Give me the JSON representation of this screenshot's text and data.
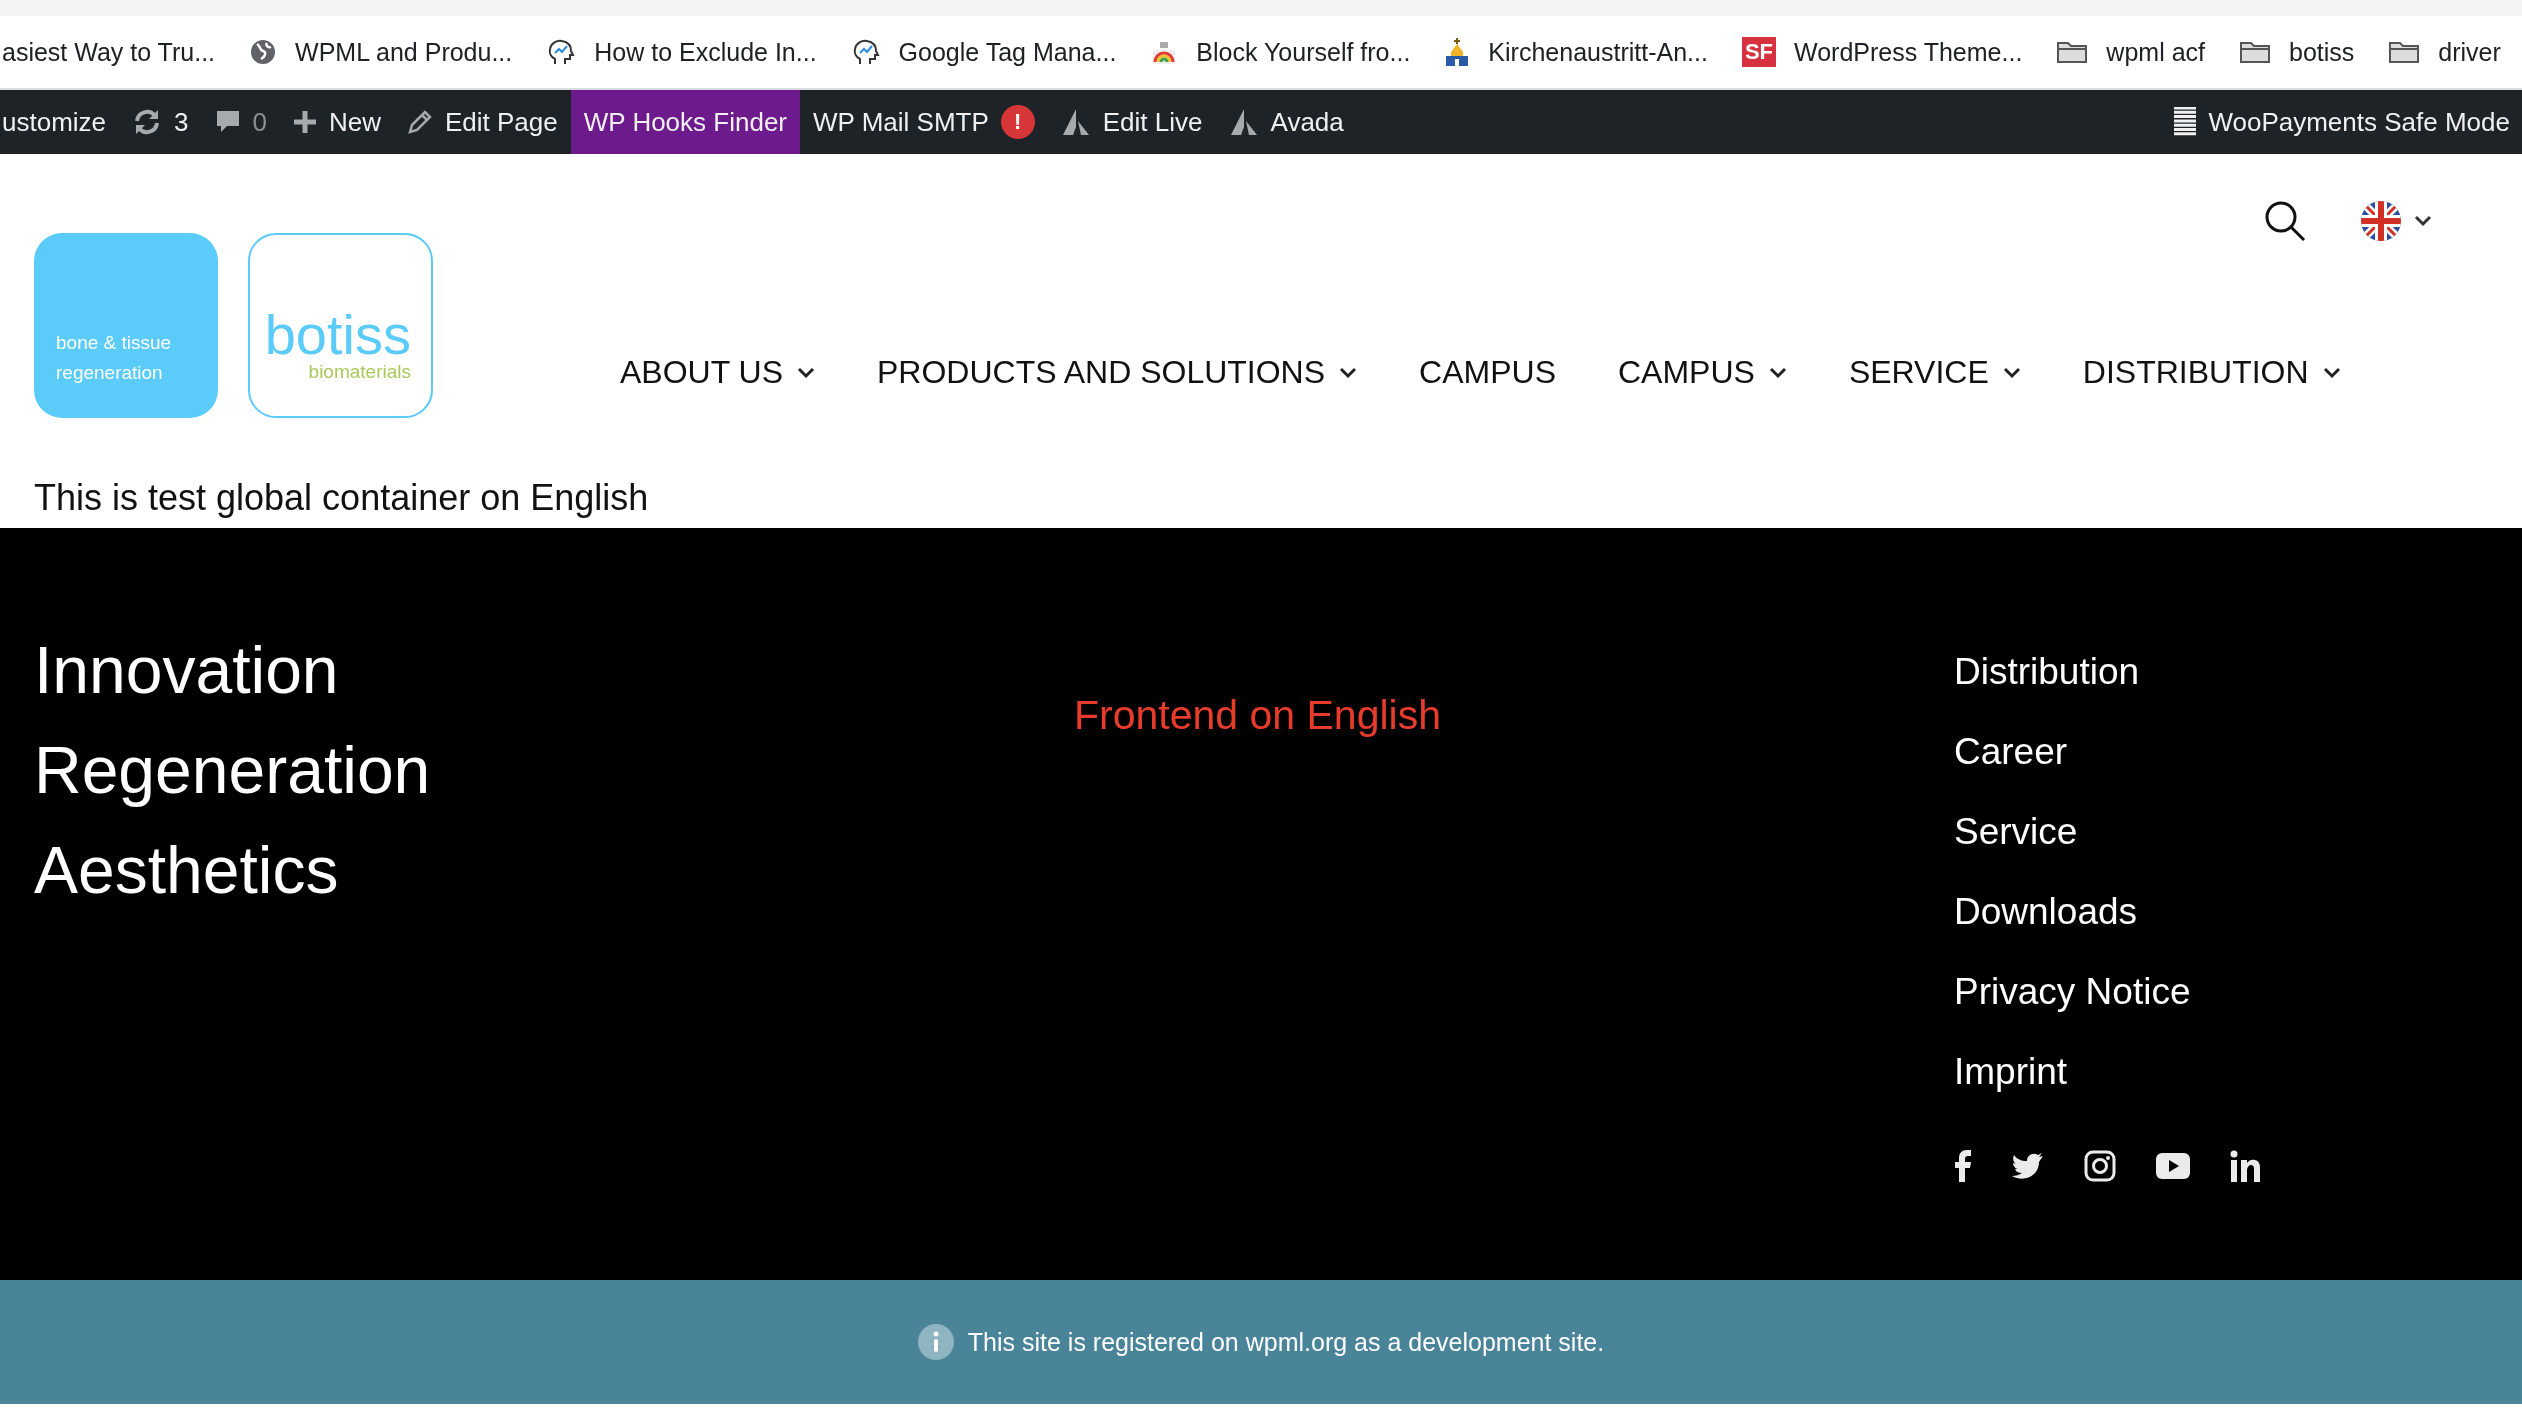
{
  "bookmarks_bar": {
    "items": [
      {
        "label": "asiest Way to Tru...",
        "kind": "none"
      },
      {
        "label": "WPML and Produ...",
        "kind": "globe"
      },
      {
        "label": "How to Exclude In...",
        "kind": "head"
      },
      {
        "label": "Google Tag Mana...",
        "kind": "head"
      },
      {
        "label": "Block Yourself fro...",
        "kind": "rainbow"
      },
      {
        "label": "Kirchenaustritt-An...",
        "kind": "church"
      },
      {
        "label": "WordPress Theme...",
        "kind": "badge",
        "badge": "SF"
      },
      {
        "label": "wpml acf",
        "kind": "folder"
      },
      {
        "label": "botiss",
        "kind": "folder"
      },
      {
        "label": "driver",
        "kind": "folder"
      }
    ]
  },
  "admin_bar": {
    "items": [
      {
        "label": "ustomize",
        "kind": "none",
        "highlighted": false
      },
      {
        "label": "3",
        "kind": "sync",
        "highlighted": false
      },
      {
        "label": "0",
        "kind": "comment",
        "highlighted": false
      },
      {
        "label": "New",
        "kind": "plus",
        "highlighted": false
      },
      {
        "label": "Edit Page",
        "kind": "pencil",
        "highlighted": false
      },
      {
        "label": "WP Hooks Finder",
        "kind": "none",
        "highlighted": true
      },
      {
        "label": "WP Mail SMTP",
        "kind": "none",
        "highlighted": false,
        "alert": "!"
      },
      {
        "label": "Edit Live",
        "kind": "avada",
        "highlighted": false
      },
      {
        "label": "Avada",
        "kind": "avada",
        "highlighted": false
      }
    ],
    "right_item": {
      "label": "WooPayments Safe Mode"
    }
  },
  "header": {
    "logo_left": {
      "line_1": "bone & tissue",
      "line_2": "regeneration"
    },
    "logo_right": {
      "name": "botiss",
      "tagline": "biomaterials"
    },
    "nav": [
      {
        "label": "ABOUT US",
        "dropdown": true
      },
      {
        "label": "PRODUCTS AND SOLUTIONS",
        "dropdown": true
      },
      {
        "label": "CAMPUS",
        "dropdown": false
      },
      {
        "label": "CAMPUS",
        "dropdown": true
      },
      {
        "label": "SERVICE",
        "dropdown": true
      },
      {
        "label": "DISTRIBUTION",
        "dropdown": true
      }
    ]
  },
  "global_container": {
    "text": "This is test global container on English"
  },
  "footer": {
    "taglines": [
      "Innovation",
      "Regeneration",
      "Aesthetics"
    ],
    "center_text": "Frontend on English",
    "links": [
      "Distribution",
      "Career",
      "Service",
      "Downloads",
      "Privacy Notice",
      "Imprint"
    ]
  },
  "notice": {
    "text": "This site is registered on wpml.org as a development site."
  }
}
